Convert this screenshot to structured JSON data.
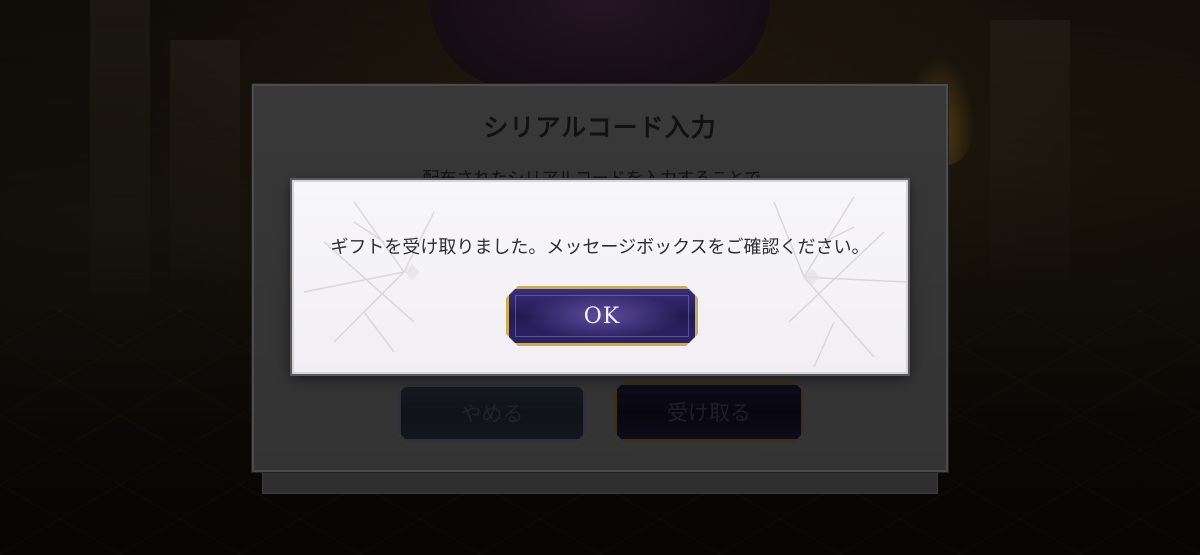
{
  "serial_dialog": {
    "title": "シリアルコード入力",
    "description": "配布されたシリアルコードを入力することで、",
    "cancel_label": "やめる",
    "receive_label": "受け取る"
  },
  "confirm_dialog": {
    "message": "ギフトを受け取りました。メッセージボックスをご確認ください。",
    "ok_label": "OK"
  },
  "colors": {
    "ok_button_fill": "#2e2466",
    "ok_button_border": "#c9ac58",
    "dialog_background": "#f4f3f6",
    "serial_panel_background": "#636262"
  }
}
